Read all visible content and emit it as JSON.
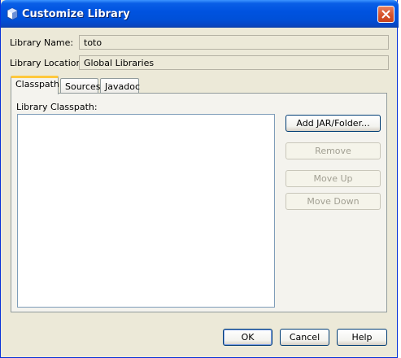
{
  "window": {
    "title": "Customize Library"
  },
  "fields": {
    "name_label": "Library Name:",
    "name_value": "toto",
    "location_label": "Library Location:",
    "location_value": "Global Libraries"
  },
  "tabs": [
    {
      "label": "Classpath",
      "active": true
    },
    {
      "label": "Sources",
      "active": false
    },
    {
      "label": "Javadoc",
      "active": false
    }
  ],
  "classpath": {
    "label": "Library Classpath:",
    "items": []
  },
  "side_buttons": {
    "add": "Add JAR/Folder...",
    "remove": "Remove",
    "move_up": "Move Up",
    "move_down": "Move Down"
  },
  "footer": {
    "ok": "OK",
    "cancel": "Cancel",
    "help": "Help"
  },
  "colors": {
    "titlebar": "#0053e0",
    "dialog_bg": "#ece9d8",
    "active_tab_accent": "#ffc83c",
    "close_button": "#d6532c"
  },
  "icons": [
    "library-cube-icon",
    "close-x-icon"
  ]
}
